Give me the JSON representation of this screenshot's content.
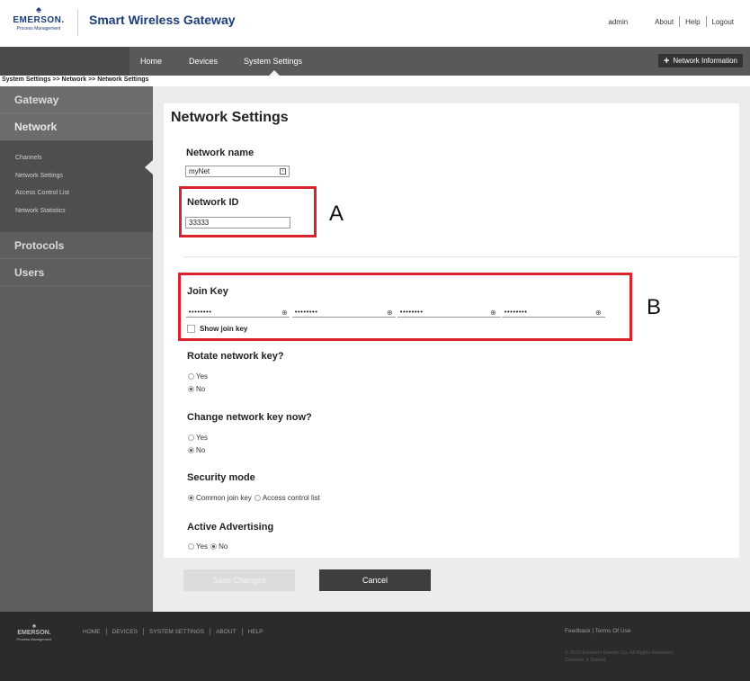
{
  "header": {
    "logo": {
      "name": "EMERSON.",
      "sub": "Process Management"
    },
    "app_title": "Smart Wireless Gateway",
    "user": "admin",
    "links": [
      "About",
      "Help",
      "Logout"
    ]
  },
  "navbar": {
    "items": [
      "Home",
      "Devices",
      "System Settings"
    ],
    "active": "System Settings",
    "network_info_label": "Network Information"
  },
  "breadcrumb": "System Settings >> Network >> Network Settings",
  "sidebar": {
    "sections": [
      "Gateway",
      "Network",
      "Protocols",
      "Users"
    ],
    "network_items": [
      "Channels",
      "Network Settings",
      "Access Control List",
      "Network Statistics"
    ],
    "active_item": "Network Settings"
  },
  "main": {
    "title": "Network Settings",
    "network_name": {
      "label": "Network name",
      "value": "myNet"
    },
    "network_id": {
      "label": "Network ID",
      "value": "33333"
    },
    "join_key": {
      "label": "Join Key",
      "values": [
        "••••••••",
        "••••••••",
        "••••••••",
        "••••••••"
      ],
      "show_label": "Show join key",
      "show_checked": false
    },
    "rotate_key": {
      "label": "Rotate network key?",
      "options": [
        "Yes",
        "No"
      ],
      "selected": "No"
    },
    "change_key": {
      "label": "Change network key now?",
      "options": [
        "Yes",
        "No"
      ],
      "selected": "No"
    },
    "security_mode": {
      "label": "Security mode",
      "options": [
        "Common join key",
        "Access control list"
      ],
      "selected": "Common join key"
    },
    "active_advertising": {
      "label": "Active Advertising",
      "options": [
        "Yes",
        "No"
      ],
      "selected": "No"
    },
    "save_label": "Save Changes",
    "cancel_label": "Cancel"
  },
  "annotations": {
    "a": "A",
    "b": "B",
    "color": "#d9232e"
  },
  "footer": {
    "logo": {
      "name": "EMERSON.",
      "sub": "Process Management"
    },
    "links": [
      "HOME",
      "DEVICES",
      "SYSTEM SETTINGS",
      "ABOUT",
      "HELP"
    ],
    "right_links": "Feedback | Terms Of Use",
    "copyright_line1": "© 2015 Emerson Electric Co. All Rights Reserved.",
    "copyright_line2": "Consider It Solved."
  },
  "colors": {
    "brand": "#1c3c78",
    "nav_bg": "#595959",
    "sidebar_bg": "#5e5e5e",
    "footer_bg": "#2b2b2b"
  }
}
